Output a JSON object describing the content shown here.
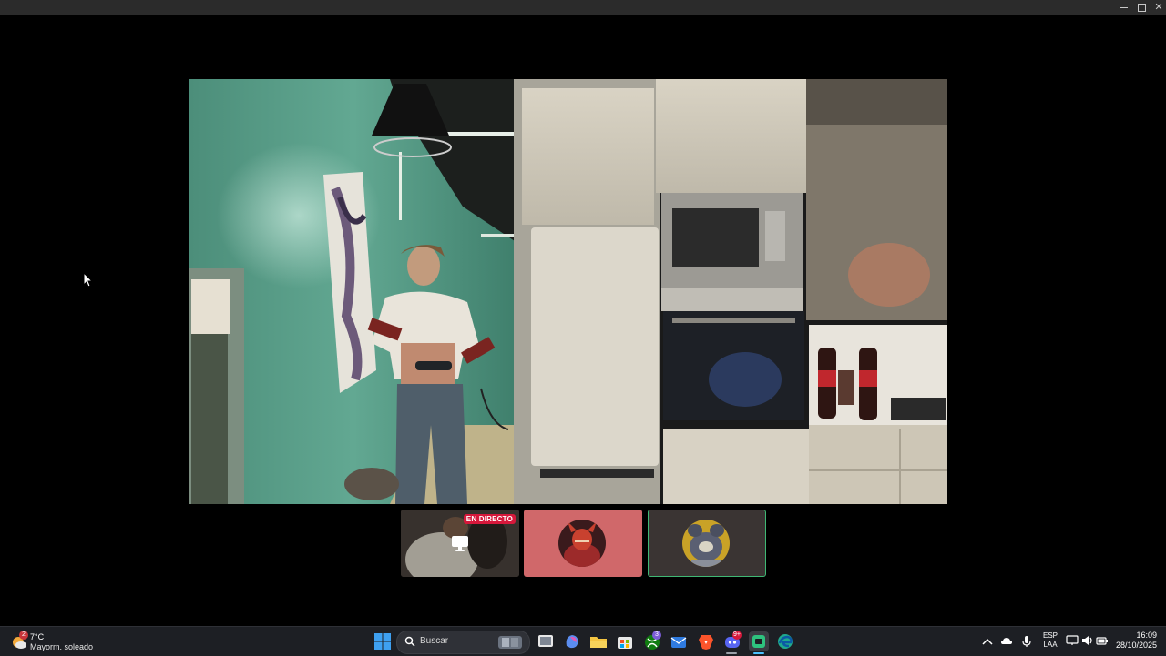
{
  "window": {
    "controls": {
      "minimize": "minimize",
      "maximize": "maximize",
      "close": "close"
    }
  },
  "stage": {
    "main_video": {
      "description_icon": "video-feed"
    },
    "participants": [
      {
        "id": "stream",
        "live_label": "EN DIRECTO",
        "icon": "screen-share-icon"
      },
      {
        "id": "user1",
        "icon": "avatar-image"
      },
      {
        "id": "user2",
        "icon": "avatar-image",
        "speaking": true
      }
    ]
  },
  "taskbar": {
    "weather": {
      "temp": "7°C",
      "desc": "Mayorm. soleado",
      "badge": "2"
    },
    "search": {
      "label": "Buscar"
    },
    "apps": [
      {
        "name": "file-explorer-icon"
      },
      {
        "name": "copilot-icon"
      },
      {
        "name": "folder-icon"
      },
      {
        "name": "store-icon"
      },
      {
        "name": "xbox-icon",
        "badge": "3"
      },
      {
        "name": "mail-icon"
      },
      {
        "name": "brave-icon"
      },
      {
        "name": "discord-icon",
        "badge": "9+"
      },
      {
        "name": "app-green-icon"
      },
      {
        "name": "edge-icon"
      }
    ],
    "tray": {
      "lang_top": "ESP",
      "lang_bottom": "LAA"
    },
    "clock": {
      "time": "16:09",
      "date": "28/10/2025"
    }
  },
  "colors": {
    "taskbar_bg": "#1d1f24",
    "live_badge": "#d6183b",
    "speaking_border": "#3fb874",
    "user1_tile": "#d0686a"
  }
}
